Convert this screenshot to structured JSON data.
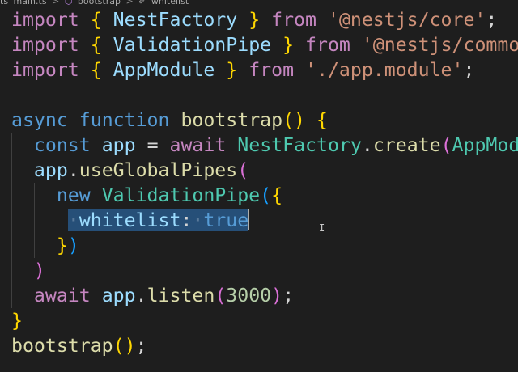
{
  "breadcrumb": {
    "file": "main.ts",
    "function": "bootstrap",
    "property": "whitelist",
    "separator": ">"
  },
  "code": {
    "line1": {
      "kw": "import",
      "open": "{",
      "name": "NestFactory",
      "close": "}",
      "from": "from",
      "source": "'@nestjs/core'",
      "end": ";"
    },
    "line2": {
      "kw": "import",
      "open": "{",
      "name": "ValidationPipe",
      "close": "}",
      "from": "from",
      "source": "'@nestjs/common'",
      "end": ";"
    },
    "line3": {
      "kw": "import",
      "open": "{",
      "name": "AppModule",
      "close": "}",
      "from": "from",
      "source": "'./app.module'",
      "end": ";"
    },
    "line5": {
      "async": "async",
      "function": "function",
      "name": "bootstrap",
      "parens": "()",
      "brace": "{"
    },
    "line6": {
      "const": "const",
      "var": "app",
      "eq": "=",
      "await": "await",
      "obj": "NestFactory",
      "dot": ".",
      "method": "create",
      "paren": "(",
      "arg": "AppModule"
    },
    "line7": {
      "obj": "app",
      "dot": ".",
      "method": "useGlobalPipes",
      "paren": "("
    },
    "line8": {
      "new": "new",
      "cls": "ValidationPipe",
      "paren": "(",
      "brace": "{"
    },
    "line9": {
      "key": "whitelist",
      "colon": ":",
      "value": "true"
    },
    "line10": {
      "brace": "}",
      "paren": ")"
    },
    "line11": {
      "paren": ")"
    },
    "line12": {
      "await": "await",
      "obj": "app",
      "dot": ".",
      "method": "listen",
      "open": "(",
      "port": "3000",
      "close": ")",
      "end": ";"
    },
    "line13": {
      "brace": "}"
    },
    "line14": {
      "name": "bootstrap",
      "parens": "()",
      "end": ";"
    }
  }
}
